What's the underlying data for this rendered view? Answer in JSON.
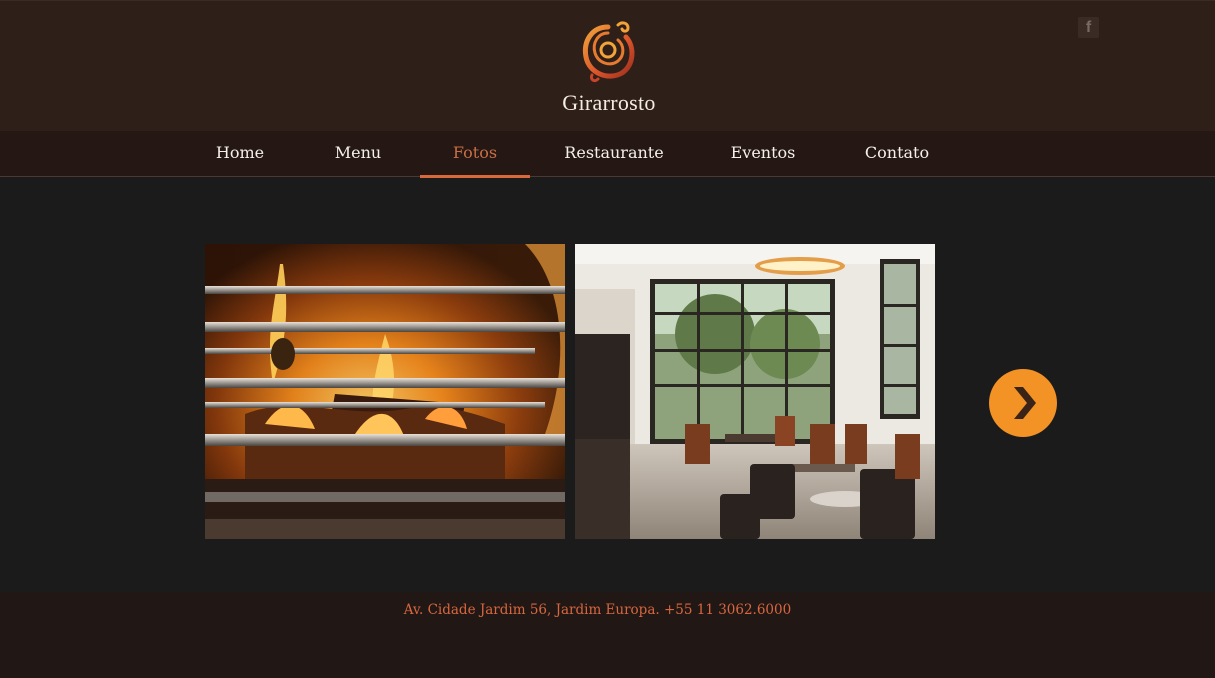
{
  "brand": {
    "name": "Girarrosto",
    "logo_icon": "swirl-logo-icon"
  },
  "social": {
    "facebook_icon": "facebook-icon",
    "facebook_glyph": "f"
  },
  "nav": {
    "items": [
      {
        "label": "Home"
      },
      {
        "label": "Menu"
      },
      {
        "label": "Fotos",
        "active": true
      },
      {
        "label": "Restaurante"
      },
      {
        "label": "Eventos"
      },
      {
        "label": "Contato"
      }
    ]
  },
  "gallery": {
    "photos": [
      {
        "subject": "rotisserie fire grill"
      },
      {
        "subject": "restaurant dining room"
      }
    ],
    "next_icon": "chevron-right-icon"
  },
  "footer": {
    "address": "Av. Cidade Jardim 56, Jardim Europa. +55 11 3062.6000"
  },
  "colors": {
    "header_bg": "#2f1f19",
    "nav_bg": "#241714",
    "page_bg": "#1c1b1b",
    "accent": "#d9693d",
    "next_button": "#f39225"
  }
}
